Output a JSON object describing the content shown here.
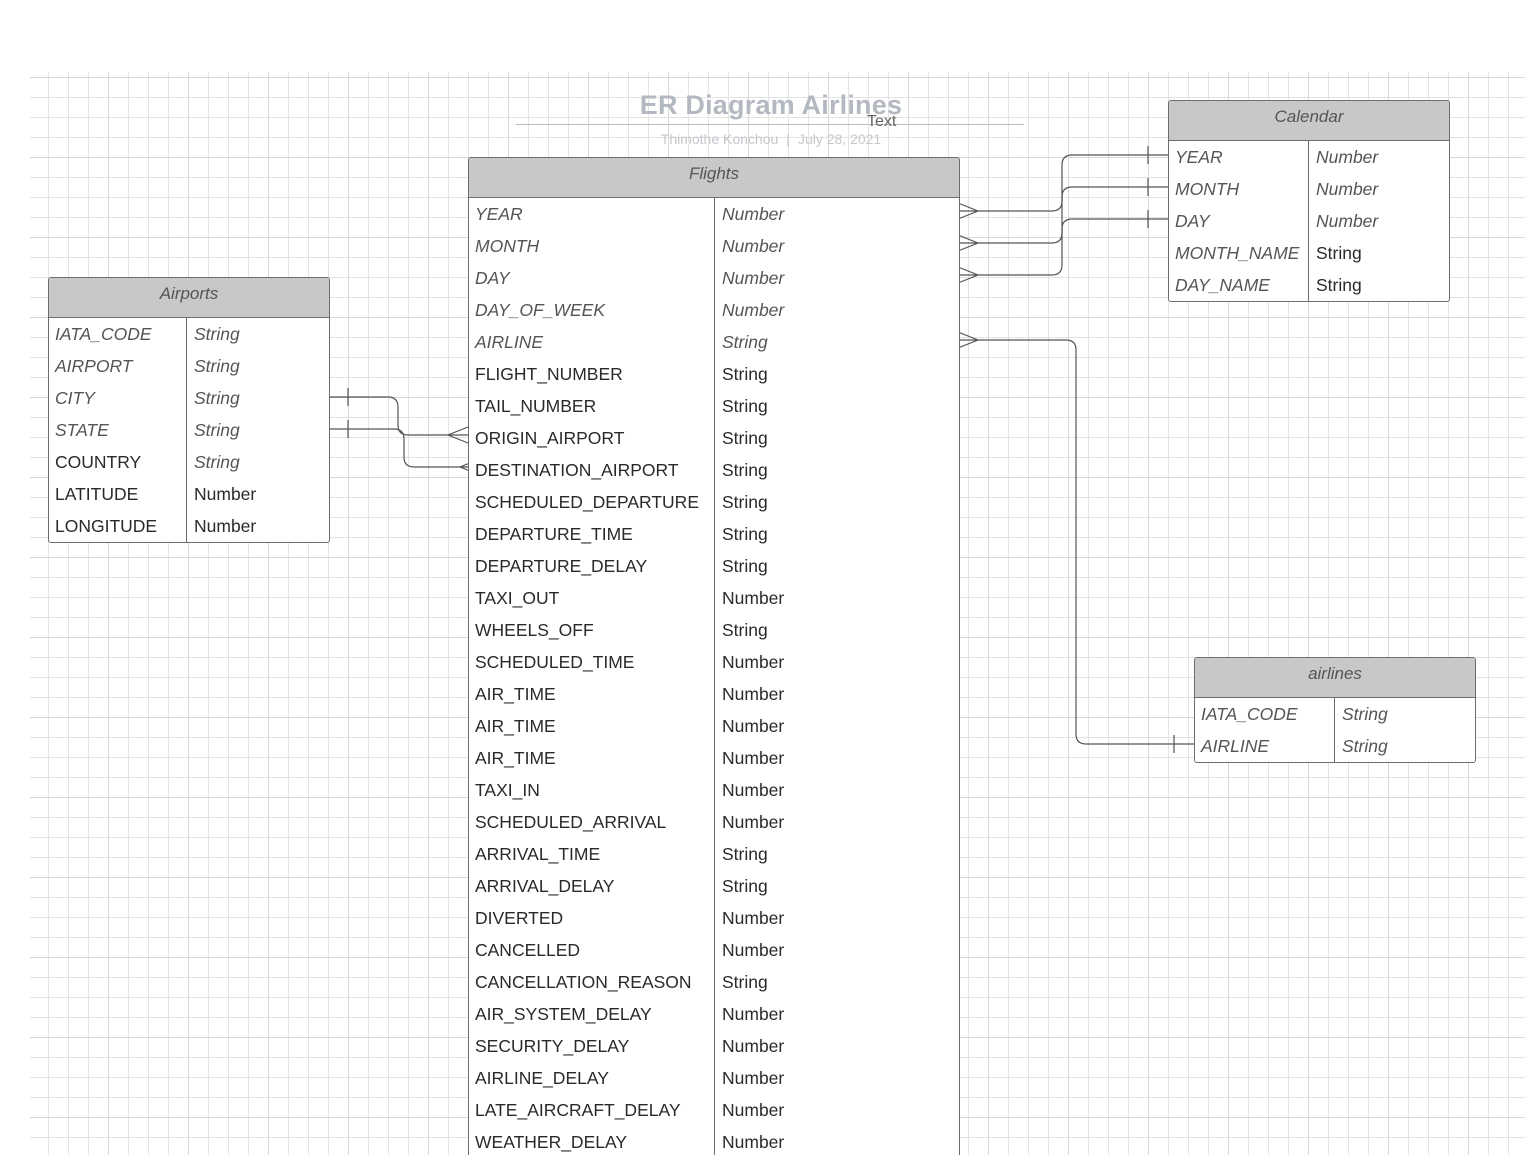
{
  "diagram": {
    "title": "ER Diagram Airlines",
    "title_tag": "Text",
    "author": "Thimothe Konchou",
    "date": "July 28, 2021",
    "separator": "|"
  },
  "entities": {
    "flights": {
      "name": "Flights",
      "rows": [
        {
          "field": "YEAR",
          "type": "Number",
          "italic": true
        },
        {
          "field": "MONTH",
          "type": "Number",
          "italic": true
        },
        {
          "field": "DAY",
          "type": "Number",
          "italic": true
        },
        {
          "field": "DAY_OF_WEEK",
          "type": "Number",
          "italic": true
        },
        {
          "field": "AIRLINE",
          "type": "String",
          "italic": true
        },
        {
          "field": "FLIGHT_NUMBER",
          "type": "String",
          "italic": false
        },
        {
          "field": "TAIL_NUMBER",
          "type": "String",
          "italic": false
        },
        {
          "field": "ORIGIN_AIRPORT",
          "type": "String",
          "italic": false
        },
        {
          "field": "DESTINATION_AIRPORT",
          "type": "String",
          "italic": false
        },
        {
          "field": "SCHEDULED_DEPARTURE",
          "type": "String",
          "italic": false
        },
        {
          "field": "DEPARTURE_TIME",
          "type": "String",
          "italic": false
        },
        {
          "field": "DEPARTURE_DELAY",
          "type": "String",
          "italic": false
        },
        {
          "field": "TAXI_OUT",
          "type": "Number",
          "italic": false
        },
        {
          "field": "WHEELS_OFF",
          "type": "String",
          "italic": false
        },
        {
          "field": "SCHEDULED_TIME",
          "type": "Number",
          "italic": false
        },
        {
          "field": "AIR_TIME",
          "type": "Number",
          "italic": false
        },
        {
          "field": "AIR_TIME",
          "type": "Number",
          "italic": false
        },
        {
          "field": "AIR_TIME",
          "type": "Number",
          "italic": false
        },
        {
          "field": "TAXI_IN",
          "type": "Number",
          "italic": false
        },
        {
          "field": "SCHEDULED_ARRIVAL",
          "type": "Number",
          "italic": false
        },
        {
          "field": "ARRIVAL_TIME",
          "type": "String",
          "italic": false
        },
        {
          "field": "ARRIVAL_DELAY",
          "type": "String",
          "italic": false
        },
        {
          "field": "DIVERTED",
          "type": "Number",
          "italic": false
        },
        {
          "field": "CANCELLED",
          "type": "Number",
          "italic": false
        },
        {
          "field": "CANCELLATION_REASON",
          "type": "String",
          "italic": false
        },
        {
          "field": "AIR_SYSTEM_DELAY",
          "type": "Number",
          "italic": false
        },
        {
          "field": "SECURITY_DELAY",
          "type": "Number",
          "italic": false
        },
        {
          "field": "AIRLINE_DELAY",
          "type": "Number",
          "italic": false
        },
        {
          "field": "LATE_AIRCRAFT_DELAY",
          "type": "Number",
          "italic": false
        },
        {
          "field": "WEATHER_DELAY",
          "type": "Number",
          "italic": false
        }
      ]
    },
    "airports": {
      "name": "Airports",
      "rows": [
        {
          "field": "IATA_CODE",
          "type": "String",
          "italic": true,
          "type_italic": true
        },
        {
          "field": "AIRPORT",
          "type": "String",
          "italic": true,
          "type_italic": true
        },
        {
          "field": "CITY",
          "type": "String",
          "italic": true,
          "type_italic": true
        },
        {
          "field": "STATE",
          "type": "String",
          "italic": true,
          "type_italic": true
        },
        {
          "field": "COUNTRY",
          "type": "String",
          "italic": false,
          "type_italic": true
        },
        {
          "field": "LATITUDE",
          "type": "Number",
          "italic": false,
          "type_italic": false
        },
        {
          "field": "LONGITUDE",
          "type": "Number",
          "italic": false,
          "type_italic": false
        }
      ]
    },
    "calendar": {
      "name": "Calendar",
      "rows": [
        {
          "field": "YEAR",
          "type": "Number",
          "italic": true,
          "type_italic": true
        },
        {
          "field": "MONTH",
          "type": "Number",
          "italic": true,
          "type_italic": true
        },
        {
          "field": "DAY",
          "type": "Number",
          "italic": true,
          "type_italic": true
        },
        {
          "field": "MONTH_NAME",
          "type": "String",
          "italic": true,
          "type_italic": false
        },
        {
          "field": "DAY_NAME",
          "type": "String",
          "italic": true,
          "type_italic": false
        }
      ]
    },
    "airlines": {
      "name": "airlines",
      "rows": [
        {
          "field": "IATA_CODE",
          "type": "String",
          "italic": true,
          "type_italic": true
        },
        {
          "field": "AIRLINE",
          "type": "String",
          "italic": true,
          "type_italic": true
        }
      ]
    }
  },
  "relationships": [
    {
      "from": "calendar.YEAR",
      "to": "flights.YEAR",
      "from_end": "one",
      "to_end": "many"
    },
    {
      "from": "calendar.MONTH",
      "to": "flights.MONTH",
      "from_end": "one",
      "to_end": "many"
    },
    {
      "from": "calendar.DAY",
      "to": "flights.DAY",
      "from_end": "one",
      "to_end": "many"
    },
    {
      "from": "airlines.AIRLINE",
      "to": "flights.AIRLINE",
      "from_end": "one",
      "to_end": "many"
    },
    {
      "from": "airports.CITY",
      "to": "flights.ORIGIN_AIRPORT",
      "from_end": "one",
      "to_end": "many"
    },
    {
      "from": "airports.STATE",
      "to": "flights.DESTINATION_AIRPORT",
      "from_end": "one",
      "to_end": "many"
    }
  ],
  "colors": {
    "header_fill": "#c8c8c8",
    "border": "#6e6e6e",
    "grid": "#e3e3e3",
    "title": "#b4b9c1",
    "connector": "#555555"
  }
}
